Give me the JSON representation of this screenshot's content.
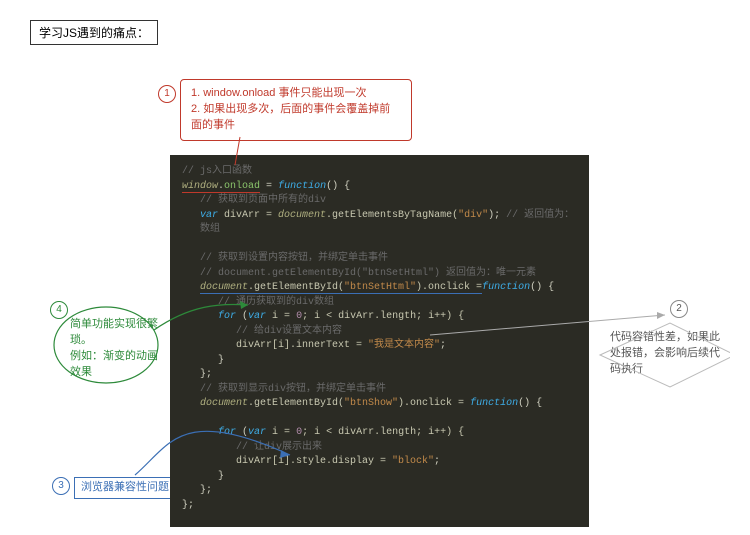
{
  "header": {
    "title": "学习JS遇到的痛点："
  },
  "callouts": {
    "c1": {
      "num": "1",
      "line1": "1. window.onload 事件只能出现一次",
      "line2": "2. 如果出现多次，后面的事件会覆盖掉前面的事件"
    },
    "c2": {
      "num": "2",
      "text": "代码容错性差，如果此处报错，会影响后续代码执行"
    },
    "c3": {
      "num": "3",
      "text": "浏览器兼容性问题"
    },
    "c4": {
      "num": "4",
      "line1": "简单功能实现很繁琐。",
      "line2": "例如：渐变的动画效果"
    }
  },
  "code": {
    "l1": "// js入口函数",
    "l2a": "window",
    "l2b": ".",
    "l2c": "onload",
    "l2d": " = ",
    "l2e": "function",
    "l2f": "() {",
    "l3": "// 获取到页面中所有的div",
    "l4a": "var",
    "l4b": " divArr = ",
    "l4c": "document",
    "l4d": ".getElementsByTagName(",
    "l4e": "\"div\"",
    "l4f": ");",
    "l4g": "  // 返回值为：数组",
    "l6": "// 获取到设置内容按钮，并绑定单击事件",
    "l7": "// document.getElementById(\"btnSetHtml\")  返回值为：唯一元素",
    "l8a": "document",
    "l8b": ".getElementById(",
    "l8c": "\"btnSetHtml\"",
    "l8d": ").onclick = ",
    "l8e": "function",
    "l8f": "() {",
    "l9": "// 通历获取到的div数组",
    "l10a": "for",
    "l10b": " (",
    "l10c": "var",
    "l10d": " i = ",
    "l10e": "0",
    "l10f": "; i < divArr.length; i++) {",
    "l11": "// 给div设置文本内容",
    "l12a": "divArr[i].innerText = ",
    "l12b": "\"我是文本内容\"",
    "l12c": ";",
    "l13": "}",
    "l14": "};",
    "l15": "// 获取到显示div按钮，并绑定单击事件",
    "l16a": "document",
    "l16b": ".getElementById(",
    "l16c": "\"btnShow\"",
    "l16d": ").onclick = ",
    "l16e": "function",
    "l16f": "() {",
    "l18a": "for",
    "l18b": " (",
    "l18c": "var",
    "l18d": " i = ",
    "l18e": "0",
    "l18f": "; i < divArr.length; i++) {",
    "l19": "// 让div展示出来",
    "l20a": "divArr[i].style.display = ",
    "l20b": "\"block\"",
    "l20c": ";",
    "l21": "}",
    "l22": "};",
    "l23": "};"
  }
}
